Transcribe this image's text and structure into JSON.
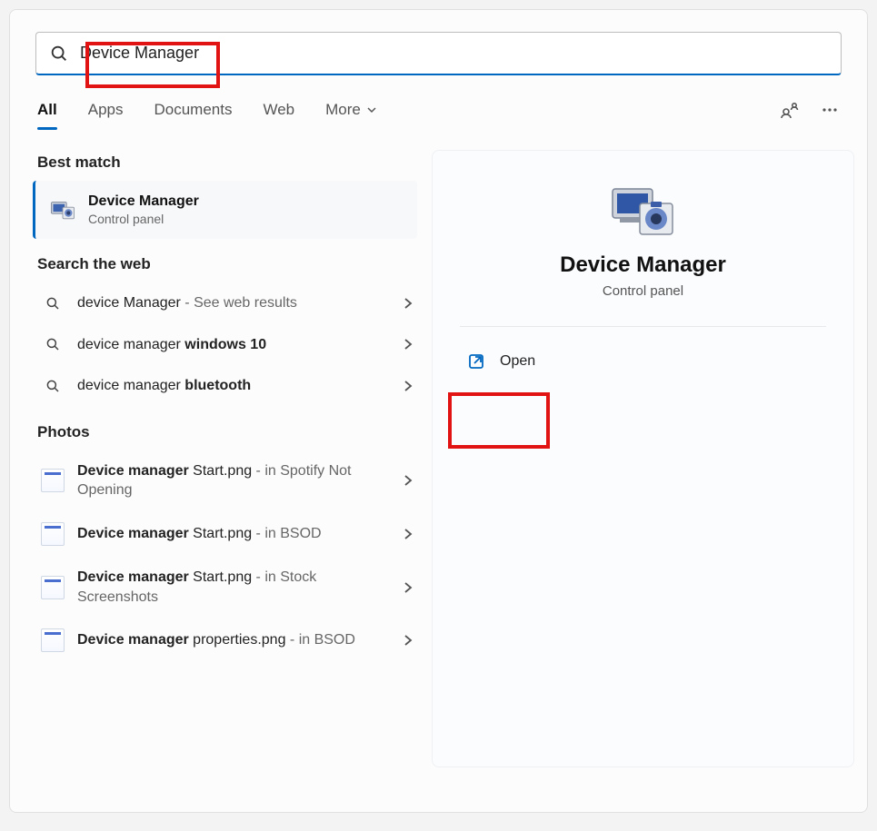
{
  "search": {
    "value": "Device Manager"
  },
  "tabs": {
    "items": [
      "All",
      "Apps",
      "Documents",
      "Web",
      "More"
    ],
    "active_index": 0
  },
  "sections": {
    "best_match": "Best match",
    "web": "Search the web",
    "photos": "Photos"
  },
  "best": {
    "title": "Device Manager",
    "subtitle": "Control panel"
  },
  "web_results": [
    {
      "prefix": "device Manager",
      "bold": "",
      "suffix": " - See web results"
    },
    {
      "prefix": "device manager ",
      "bold": "windows 10",
      "suffix": ""
    },
    {
      "prefix": "device manager ",
      "bold": "bluetooth",
      "suffix": ""
    }
  ],
  "photos": [
    {
      "bold": "Device manager",
      "rest": " Start.png",
      "loc": " - in Spotify Not Opening"
    },
    {
      "bold": "Device manager",
      "rest": " Start.png",
      "loc": " - in BSOD"
    },
    {
      "bold": "Device manager",
      "rest": " Start.png",
      "loc": " - in Stock Screenshots"
    },
    {
      "bold": "Device manager",
      "rest": " properties.png",
      "loc": " - in BSOD"
    }
  ],
  "preview": {
    "title": "Device Manager",
    "subtitle": "Control panel",
    "open_label": "Open"
  }
}
